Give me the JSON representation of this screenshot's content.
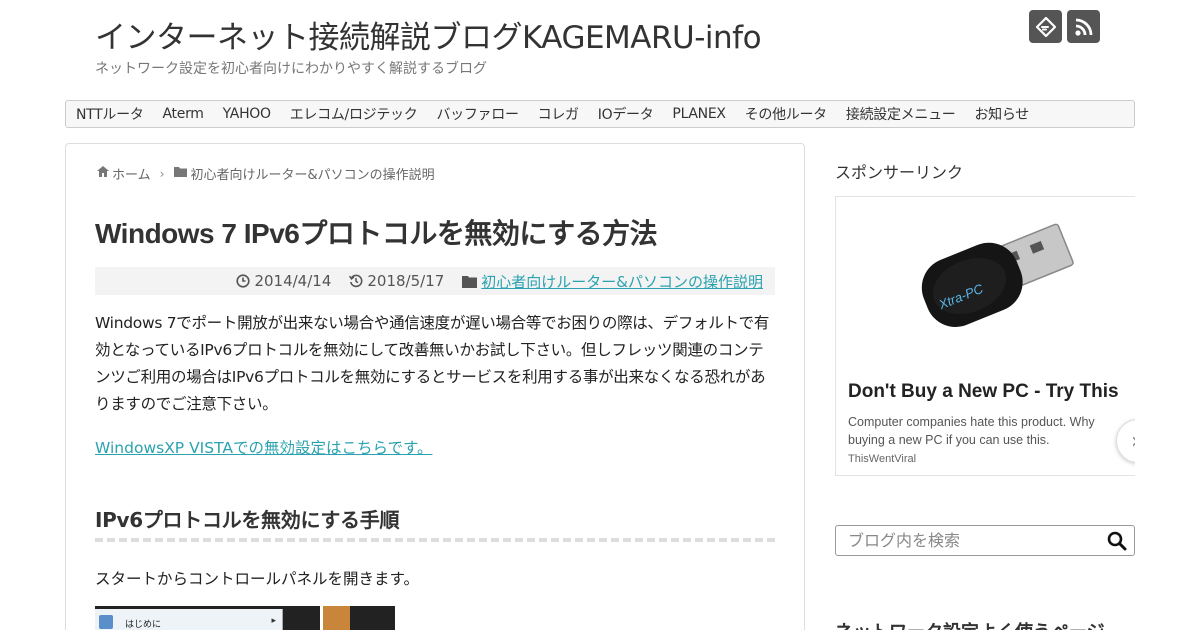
{
  "site": {
    "title": "インターネット接続解説ブログKAGEMARU-info",
    "tagline": "ネットワーク設定を初心者向けにわかりやすく解説するブログ"
  },
  "top_icons": [
    {
      "icon": "feedly-icon"
    },
    {
      "icon": "rss-icon"
    }
  ],
  "nav": {
    "items": [
      "NTTルータ",
      "Aterm",
      "YAHOO",
      "エレコム/ロジテック",
      "バッファロー",
      "コレガ",
      "IOデータ",
      "PLANEX",
      "その他ルータ",
      "接続設定メニュー",
      "お知らせ"
    ]
  },
  "breadcrumb": {
    "home": "ホーム",
    "category": "初心者向けルーター&パソコンの操作説明"
  },
  "article": {
    "title": "Windows 7 IPv6プロトコルを無効にする方法",
    "published": "2014/4/14",
    "updated": "2018/5/17",
    "category": "初心者向けルーター&パソコンの操作説明",
    "intro": "Windows 7でポート開放が出来ない場合や通信速度が遅い場合等でお困りの際は、デフォルトで有効となっているIPv6プロトコルを無効にして改善無いかお試し下さい。但しフレッツ関連のコンテンツご利用の場合はIPv6プロトコルを無効にするとサービスを利用する事が出来なくなる恐れがありますのでご注意下さい。",
    "xp_link": "WindowsXP VISTAでの無効設定はこちらです。",
    "section_heading": "IPv6プロトコルを無効にする手順",
    "step1": "スタートからコントロールパネルを開きます。",
    "screenshot_menu_label": "はじめに"
  },
  "sidebar": {
    "sponsor_heading": "スポンサーリンク",
    "ad": {
      "title": "Don't Buy a New PC - Try This",
      "description": "Computer companies hate this product. Why buying a new PC if you can use this.",
      "source": "ThisWentViral",
      "product_logo": "Xtra-PC"
    },
    "search_placeholder": "ブログ内を検索",
    "next_heading": "ネットワーク設定よく使うページ"
  },
  "colors": {
    "link": "#2aa2b0",
    "icon_bg": "#555555"
  }
}
